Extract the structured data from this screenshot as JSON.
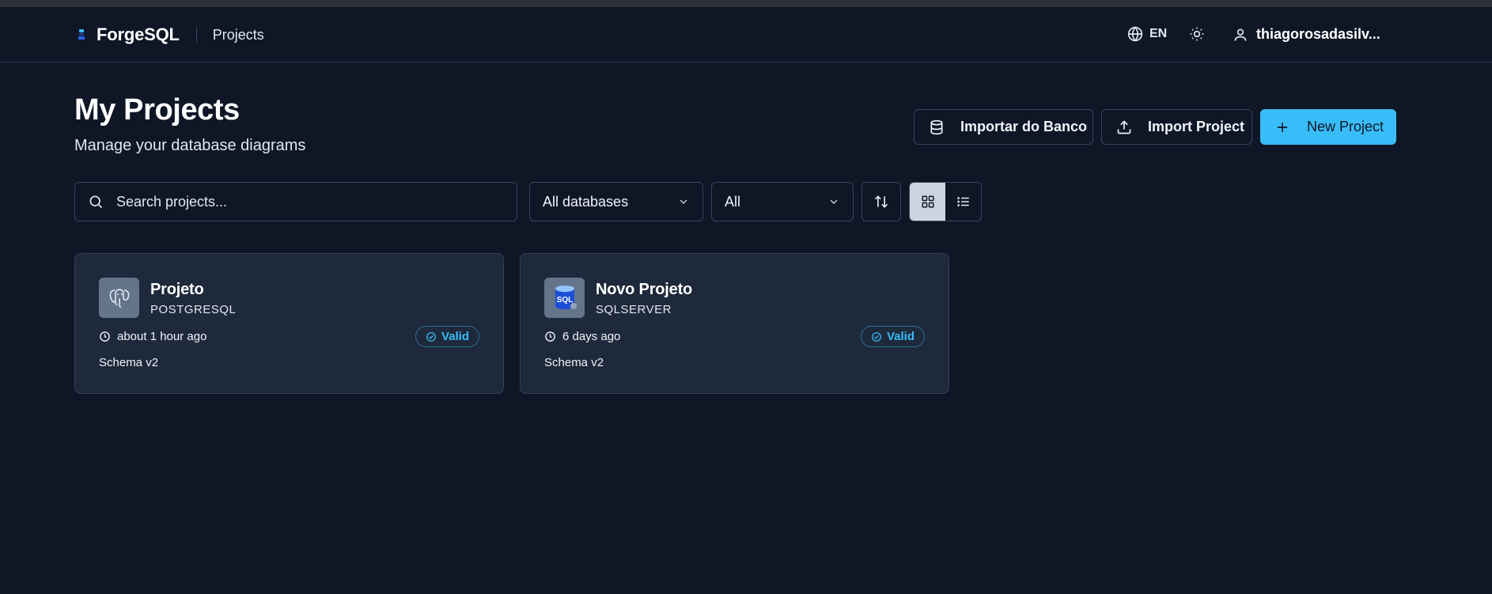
{
  "header": {
    "brand": "ForgeSQL",
    "breadcrumb": "Projects",
    "language": "EN",
    "username": "thiagorosadasilv..."
  },
  "page": {
    "title": "My Projects",
    "subtitle": "Manage your database diagrams"
  },
  "actions": {
    "import_db": "Importar do Banco",
    "import_project": "Import Project",
    "new_project": "New Project"
  },
  "filters": {
    "search_placeholder": "Search projects...",
    "database": "All databases",
    "status": "All"
  },
  "colors": {
    "background": "#0f1626",
    "card": "#1e293b",
    "accent": "#38bdf8"
  },
  "projects": [
    {
      "name": "Projeto",
      "db_type": "POSTGRESQL",
      "icon": "postgresql-icon",
      "updated": "about 1 hour ago",
      "status": "Valid",
      "version": "Schema v2"
    },
    {
      "name": "Novo Projeto",
      "db_type": "SQLSERVER",
      "icon": "sqlserver-icon",
      "updated": "6 days ago",
      "status": "Valid",
      "version": "Schema v2",
      "icon_text": "SQL"
    }
  ]
}
